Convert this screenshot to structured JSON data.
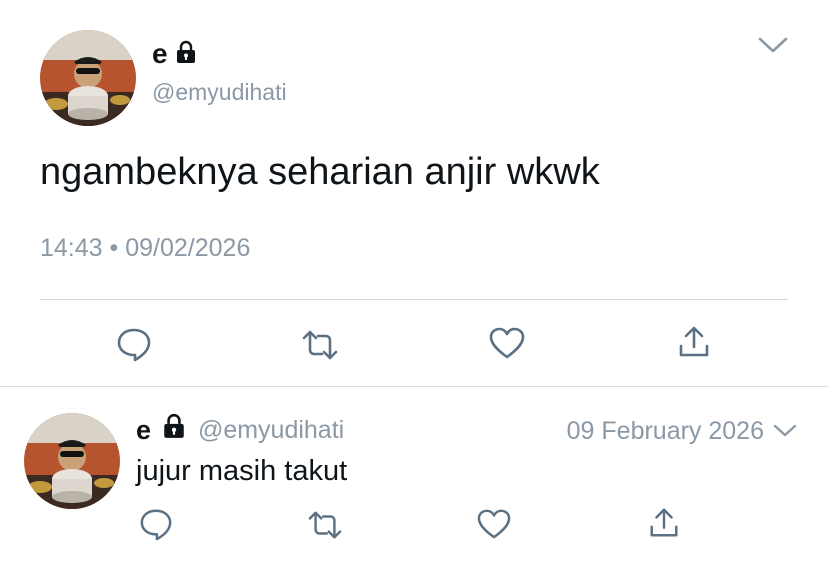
{
  "main_tweet": {
    "display_name": "e",
    "handle": "@emyudihati",
    "text": "ngambeknya seharian anjir wkwk",
    "time": "14:43",
    "separator": "•",
    "date": "09/02/2026"
  },
  "reply_tweet": {
    "display_name": "e",
    "handle": "@emyudihati",
    "date": "09 February 2026",
    "text": "jujur masih takut"
  },
  "icons": {
    "reply": "reply-icon",
    "retweet": "retweet-icon",
    "like": "heart-icon",
    "share": "share-icon",
    "menu": "chevron-down-icon",
    "protected": "lock-icon"
  },
  "colors": {
    "text": "#0f1419",
    "secondary": "#8b98a5",
    "icon": "#5b7083",
    "divider": "#cfd9de"
  }
}
